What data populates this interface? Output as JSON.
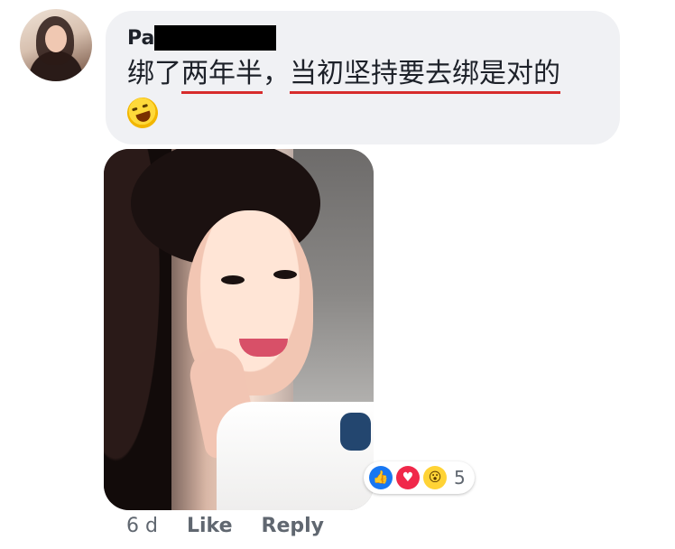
{
  "comment": {
    "author_partial": "Pa",
    "text_parts": [
      "绑了",
      "两年半",
      "，",
      "当初坚持要去绑是对的"
    ],
    "emoji": "rofl-emoji",
    "underline_color": "#d72c2c"
  },
  "reactions": {
    "count": "5",
    "icons": [
      "like-icon",
      "love-icon",
      "wow-icon"
    ]
  },
  "meta": {
    "time": "6 d",
    "like_label": "Like",
    "reply_label": "Reply"
  },
  "colors": {
    "bubble_bg": "#f0f1f4",
    "text": "#1d2129",
    "meta_text": "#606770",
    "like_blue": "#1877f2",
    "love_red": "#f0284a"
  }
}
